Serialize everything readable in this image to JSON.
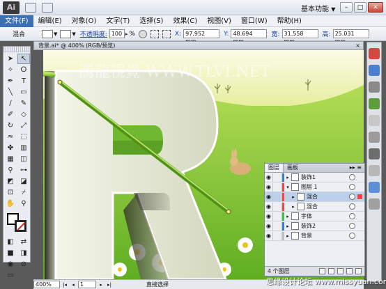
{
  "titlebar": {
    "app_logo": "Ai",
    "workspace_label": "基本功能",
    "workspace_arrow": "▼"
  },
  "menubar": {
    "items": [
      "文件(F)",
      "编辑(E)",
      "对象(O)",
      "文字(T)",
      "选择(S)",
      "效果(C)",
      "视图(V)",
      "窗口(W)",
      "帮助(H)"
    ]
  },
  "controlbar": {
    "selection_label": "混合",
    "opacity_label": "不透明度:",
    "opacity_value": "100",
    "opacity_unit": "%",
    "x_label": "X:",
    "x_value": "97.952 mm",
    "y_label": "Y:",
    "y_value": "48.694 mm",
    "w_label": "宽:",
    "w_value": "31.558 mm",
    "h_label": "高:",
    "h_value": "25.031 mm"
  },
  "document": {
    "tab_title": "背景.ai* @ 400% (RGB/预览)",
    "close_glyph": "×"
  },
  "canvas": {
    "watermark": "腾龍視覺 WWW.TLVI.NET",
    "colors": {
      "sky": "#f1f4b4",
      "grass": "#7fc43a",
      "letter": "#e9ebd8",
      "stem": "#5fa21c"
    }
  },
  "statusbar": {
    "zoom": "400%",
    "page": "1",
    "status_text": "直接选择"
  },
  "layers_panel": {
    "tabs": [
      "图层",
      "画板"
    ],
    "menu_glyph": "▸▸ ≡",
    "rows": [
      {
        "name": "装饰1",
        "color": "#3a7be0",
        "indent": 0,
        "expanded": false,
        "selected": false
      },
      {
        "name": "图层 1",
        "color": "#ff4040",
        "indent": 0,
        "expanded": true,
        "selected": false
      },
      {
        "name": "混合",
        "color": "#ff4040",
        "indent": 1,
        "expanded": false,
        "selected": true
      },
      {
        "name": "混合",
        "color": "#ff4040",
        "indent": 1,
        "expanded": false,
        "selected": false
      },
      {
        "name": "字体",
        "color": "#3cc63c",
        "indent": 0,
        "expanded": false,
        "selected": false
      },
      {
        "name": "装饰2",
        "color": "#3a7be0",
        "indent": 0,
        "expanded": false,
        "selected": false
      },
      {
        "name": "背景",
        "color": "#c0c0c0",
        "indent": 0,
        "expanded": false,
        "selected": false
      }
    ],
    "footer_count": "4 个图层"
  },
  "watermark_bottom": "思缘设计论坛 www.missyuan.com"
}
